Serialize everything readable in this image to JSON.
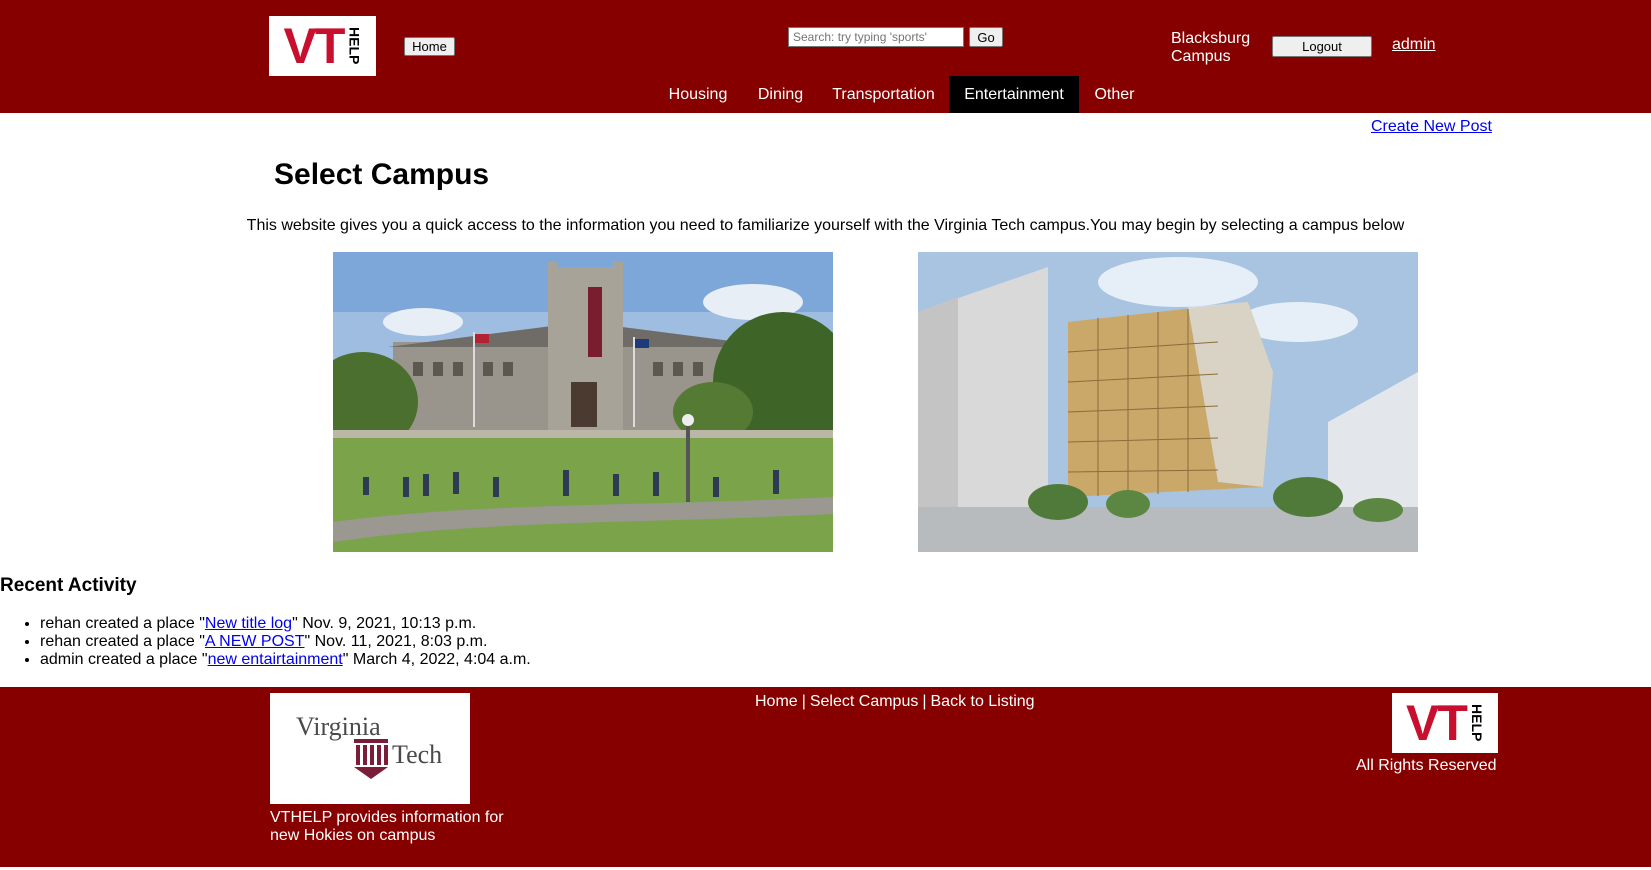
{
  "header": {
    "logo_text": "VT",
    "logo_sub": "HELP",
    "home_label": "Home",
    "search_placeholder": "Search: try typing 'sports'",
    "go_label": "Go",
    "campus_label": "Blacksburg Campus",
    "logout_label": "Logout",
    "user_label": "admin"
  },
  "nav": {
    "items": [
      {
        "label": "Housing"
      },
      {
        "label": "Dining"
      },
      {
        "label": "Transportation"
      },
      {
        "label": "Entertainment"
      },
      {
        "label": "Other"
      }
    ],
    "active": "Entertainment"
  },
  "main": {
    "create_post_label": "Create New Post",
    "title": "Select Campus",
    "intro": "This website gives you a quick access to the information you need to familiarize yourself with the Virginia Tech campus.You may begin by selecting a campus below",
    "recent_title": "Recent Activity",
    "activities": [
      {
        "prefix": "rehan created a place \"",
        "link": "New title log",
        "suffix": "\" Nov. 9, 2021, 10:13 p.m."
      },
      {
        "prefix": "rehan created a place \"",
        "link": "A NEW POST",
        "suffix": "\" Nov. 11, 2021, 8:03 p.m."
      },
      {
        "prefix": "admin created a place \"",
        "link": "new entairtainment",
        "suffix": "\" March 4, 2022, 4:04 a.m."
      }
    ]
  },
  "footer": {
    "vt_logo_line1": "Virginia",
    "vt_logo_line2": "Tech",
    "description": "VTHELP provides information for new Hokies on campus",
    "links": [
      {
        "label": "Home"
      },
      {
        "label": "Select Campus"
      },
      {
        "label": "Back to Listing"
      }
    ],
    "logo_text": "VT",
    "logo_sub": "HELP",
    "rights": "All Rights Reserved"
  },
  "colors": {
    "brand": "#870000",
    "accent": "#c8102e",
    "active_nav": "#000000",
    "link": "#0000ee"
  }
}
